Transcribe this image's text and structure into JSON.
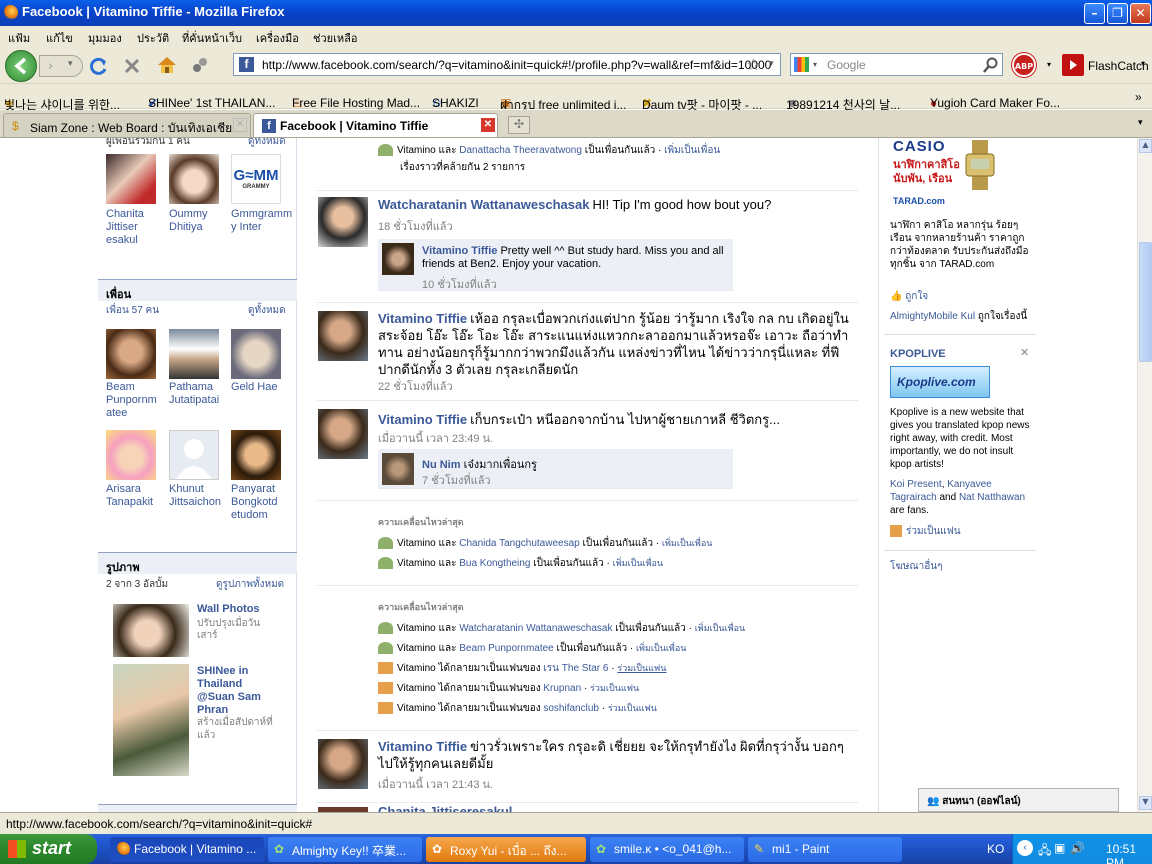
{
  "window": {
    "title": "Facebook | Vitamino Tiffie - Mozilla Firefox"
  },
  "menu": [
    "แฟ้ม",
    "แก้ไข",
    "มุมมอง",
    "ประวัติ",
    "ที่คั่นหน้าเว็บ",
    "เครื่องมือ",
    "ช่วยเหลือ"
  ],
  "nav": {
    "url": "http://www.facebook.com/search/?q=vitamino&init=quick#!/profile.php?v=wall&ref=mf&id=10000",
    "search_placeholder": "Google",
    "addon_label": "FlashCatch"
  },
  "bookmarks": [
    "빛나는 샤이니를 위한...",
    "SHINee' 1st THAILAN...",
    "Free File Hosting Mad...",
    "SHAKIZI",
    "ฝากรูป free unlimited i...",
    "Daum tv팟 - 마이팟 - ...",
    "19891214 천사의 날...",
    "Yugioh Card Maker Fo..."
  ],
  "tabs": [
    {
      "label": "Siam Zone : Web Board : บันเทิงเอเชีย"
    },
    {
      "label": "Facebook | Vitamino Tiffie"
    }
  ],
  "left": {
    "top_partial": "ผู้เพื่อนร่วมกัน 1 คน",
    "top_partial_link": "ดูทั้งหมด",
    "mutual": [
      {
        "name": "Chanita Jittiser esakul"
      },
      {
        "name": "Oummy Dhitiya"
      },
      {
        "name": "Gmmgramm y Inter"
      }
    ],
    "friends_header": "เพื่อน",
    "friends_count": "เพื่อน 57 คน",
    "friends_all": "ดูทั้งหมด",
    "friends": [
      {
        "name": "Beam Punpornm atee"
      },
      {
        "name": "Pathama Jutatipatai"
      },
      {
        "name": "Geld Hae"
      },
      {
        "name": "Arisara Tanapakit"
      },
      {
        "name": "Khunut Jittsaichon"
      },
      {
        "name": "Panyarat Bongkotd etudom"
      }
    ],
    "photos_header": "รูปภาพ",
    "photos_count": "2 จาก 3 อัลบั้ม",
    "photos_all": "ดูรูปภาพทั้งหมด",
    "albums": [
      {
        "title": "Wall Photos",
        "sub": "ปรับปรุงเมื่อวันเสาร์"
      },
      {
        "title": "SHINee in Thailand @Suan Sam Phran",
        "sub": "สร้างเมื่อสัปดาห์ที่แล้ว"
      }
    ]
  },
  "feed": {
    "top_row": {
      "who": "Vitamino และ",
      "link": "Danattacha Theeravatwong",
      "text": "เป็นเพื่อนกันแล้ว",
      "action": "เพิ่มเป็นเพื่อน"
    },
    "top_similar": "เรื่องราวที่คล้ายกัน 2 รายการ",
    "posts": [
      {
        "author": "Watcharatanin Wattanaweschasak",
        "text": "HI! Tip I'm good how bout you?",
        "time": "18 ชั่วโมงที่แล้ว",
        "comment": {
          "author": "Vitamino Tiffie",
          "text": "Pretty well ^^ But study hard. Miss you and all friends at Ben2. Enjoy your vacation.",
          "time": "10 ชั่วโมงที่แล้ว"
        }
      },
      {
        "author": "Vitamino Tiffie",
        "text": "เห้ออ กรุละเบื่อพวกเก่งแต่ปาก รู้น้อย ว่ารู้มาก เริงใจ กล กบ เกิดอยู่ใน สระจ้อย โอ๊ะ โอ๊ะ โอะ โอ๊ะ สาระแนแห่งแหวกกะลาออกมาแล้วหรอจ๊ะ เอาวะ ถือว่าทำทาน อย่างน้อยกรุก็รู้มากกว่าพวกมึงแล้วกัน แหล่งข่าวที่ไหน ได้ข่าวว่ากรุนี่แหละ ที่ฟี ปากดีนักทั้ง 3 ตัวเลย กรุละเกลียดนัก",
        "time": "22 ชั่วโมงที่แล้ว"
      },
      {
        "author": "Vitamino Tiffie",
        "text": "เก็บกระเป๋า หนีออกจากบ้าน ไปหาผู้ชายเกาหลี ชีวิตกรู...",
        "time": "เมื่อวานนี้ เวลา 23:49 น.",
        "comment": {
          "author": "Nu Nim",
          "text": "เจ๋งมากเพื่อนกรู",
          "time": "7 ชั่วโมงที่แล้ว"
        }
      }
    ],
    "recent1": {
      "title": "ความเคลื่อนไหวล่าสุด",
      "rows": [
        {
          "who": "Vitamino และ",
          "link": "Chanida Tangchutaweesap",
          "text": "เป็นเพื่อนกันแล้ว",
          "action": "เพิ่มเป็นเพื่อน"
        },
        {
          "who": "Vitamino และ",
          "link": "Bua Kongtheing",
          "text": "เป็นเพื่อนกันแล้ว",
          "action": "เพิ่มเป็นเพื่อน"
        }
      ]
    },
    "recent2": {
      "title": "ความเคลื่อนไหวล่าสุด",
      "rows": [
        {
          "who": "Vitamino และ",
          "link": "Watcharatanin Wattanaweschasak",
          "text": "เป็นเพื่อนกันแล้ว",
          "action": "เพิ่มเป็นเพื่อน"
        },
        {
          "who": "Vitamino และ",
          "link": "Beam Punpornmatee",
          "text": "เป็นเพื่อนกันแล้ว",
          "action": "เพิ่มเป็นเพื่อน"
        },
        {
          "who": "Vitamino ได้กลายมาเป็นแฟนของ",
          "link": "เรน The Star 6",
          "text": "",
          "action": "ร่วมเป็นแฟน"
        },
        {
          "who": "Vitamino ได้กลายมาเป็นแฟนของ",
          "link": "Krupnan",
          "text": "",
          "action": "ร่วมเป็นแฟน"
        },
        {
          "who": "Vitamino ได้กลายมาเป็นแฟนของ",
          "link": "soshifanclub",
          "text": "",
          "action": "ร่วมเป็นแฟน"
        }
      ]
    },
    "last_post": {
      "author": "Vitamino Tiffie",
      "text": "ข่าวรั่วเพราะใคร กรุอะดิ เชี่ยยย จะให้กรุทำยังไง ผิดที่กรุว่างั้น บอกๆไปให้รู้ทุกคนเลยดีมั้ย",
      "time": "เมื่อวานนี้ เวลา 21:43 น."
    },
    "cut_post": "Chanita Jittiseresakul"
  },
  "right": {
    "ad1": {
      "brand": "CASIO",
      "headline": "นาฬิกาคาสิโอ นับพัน, เรือน",
      "site": "TARAD.com",
      "body": "นาฬิกา คาสิโอ หลากรุ่น ร้อยๆ เรือน จากหลายร้านค้า ราคาถูกกว่าท้องตลาด รับประกันส่งถึงมือทุกชิ้น จาก TARAD.com",
      "like": "ถูกใจ",
      "liker": "AlmightyMobile Kul",
      "liked_text": "ถูกใจเรื่องนี้"
    },
    "ad2": {
      "title": "KPOPLIVE",
      "logo": "Kpoplive.com",
      "body": "Kpoplive is a new website that gives you translated kpop news right away, with credit. Most importantly, we do not insult kpop artists!",
      "fan1": "Koi Present",
      "fan2": "Kanyavee Tagrairach",
      "and": "and",
      "fan3": "Nat Natthawan",
      "are_fans": "are fans.",
      "become_fan": "ร่วมเป็นแฟน"
    },
    "more_ads": "โฆษณาอื่นๆ",
    "chat": "สนทนา (ออฟไลน์)"
  },
  "status": "http://www.facebook.com/search/?q=vitamino&init=quick#",
  "taskbar": {
    "start": "start",
    "items": [
      "Facebook | Vitamino ...",
      "Almighty Key!! 卒業...",
      "Roxy Yui - เบื่อ ... ถึง...",
      "smile.ĸ • <o_041@h...",
      "mi1 - Paint"
    ],
    "lang": "KO",
    "clock": "10:51 PM"
  },
  "colors": {
    "fb_blue": "#3b5998",
    "xp_blue": "#0a5fe8",
    "start_green": "#3c9a3c"
  }
}
